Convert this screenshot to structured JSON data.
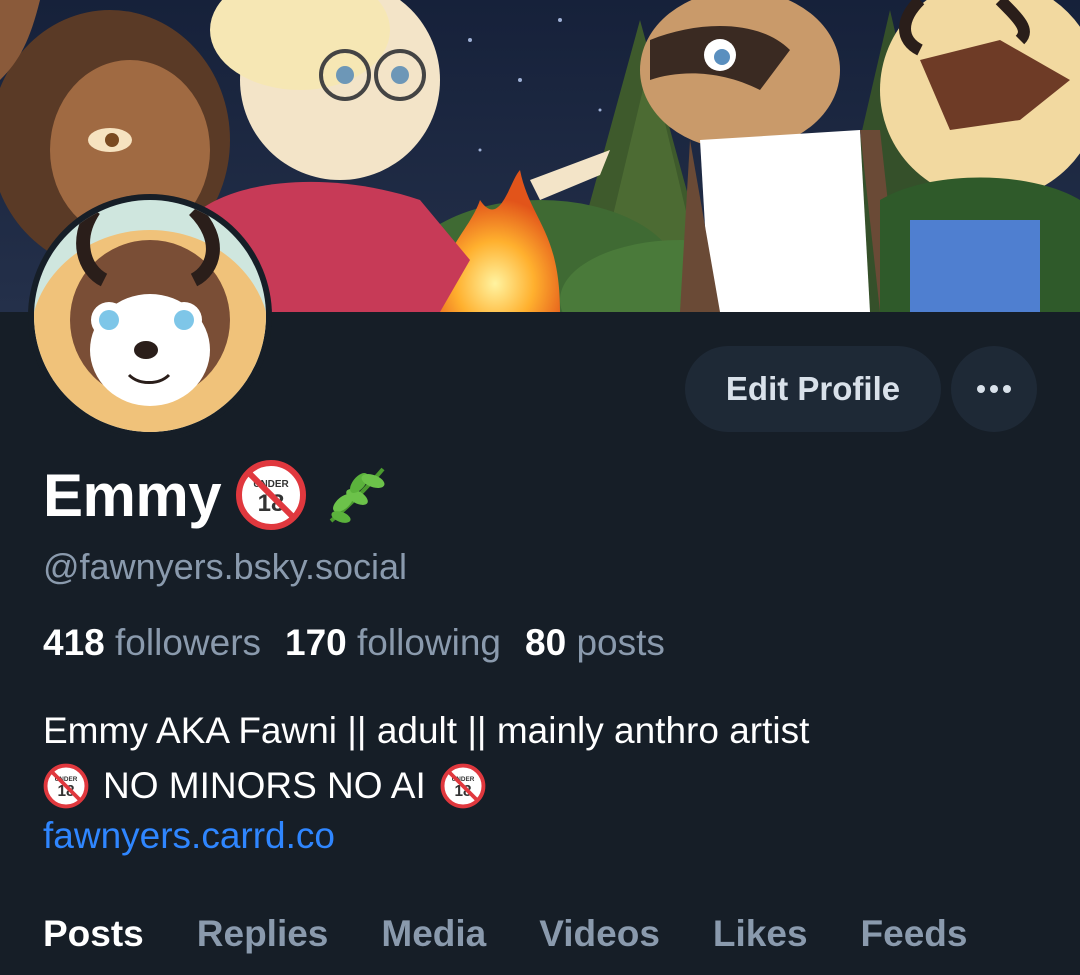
{
  "profile": {
    "display_name": "Emmy",
    "handle": "@fawnyers.bsky.social",
    "name_badges": [
      "no-under-18-icon",
      "herb-icon"
    ]
  },
  "actions": {
    "edit_profile_label": "Edit Profile",
    "more_label": "..."
  },
  "stats": {
    "followers_count": "418",
    "followers_label": "followers",
    "following_count": "170",
    "following_label": "following",
    "posts_count": "80",
    "posts_label": "posts"
  },
  "bio": {
    "line1": "Emmy AKA Fawni || adult || mainly anthro artist",
    "line2": "NO MINORS NO AI",
    "link": "fawnyers.carrd.co"
  },
  "tabs": [
    {
      "label": "Posts",
      "active": true
    },
    {
      "label": "Replies",
      "active": false
    },
    {
      "label": "Media",
      "active": false
    },
    {
      "label": "Videos",
      "active": false
    },
    {
      "label": "Likes",
      "active": false
    },
    {
      "label": "Feeds",
      "active": false
    }
  ],
  "colors": {
    "background": "#161e27",
    "button_bg": "#1e2936",
    "muted_text": "#8a9aad",
    "link": "#2f86ff"
  }
}
